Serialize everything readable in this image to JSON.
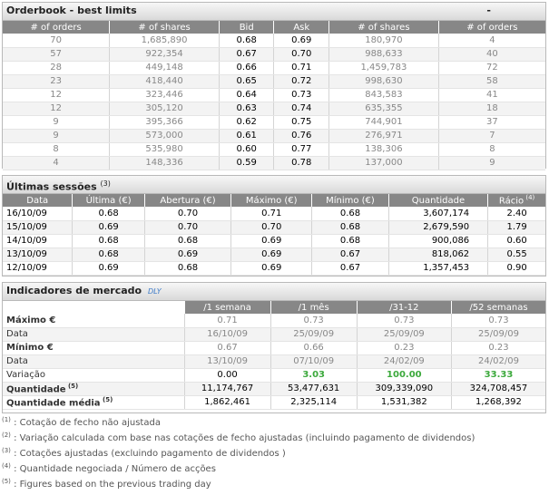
{
  "orderbook": {
    "title": "Orderbook - best limits",
    "collapse_label": "-",
    "columns": [
      "# of orders",
      "# of shares",
      "Bid",
      "Ask",
      "# of shares",
      "# of orders"
    ],
    "rows": [
      [
        "70",
        "1,685,890",
        "0.68",
        "0.69",
        "180,970",
        "4"
      ],
      [
        "57",
        "922,354",
        "0.67",
        "0.70",
        "988,633",
        "40"
      ],
      [
        "28",
        "449,148",
        "0.66",
        "0.71",
        "1,459,783",
        "72"
      ],
      [
        "23",
        "418,440",
        "0.65",
        "0.72",
        "998,630",
        "58"
      ],
      [
        "12",
        "323,446",
        "0.64",
        "0.73",
        "843,583",
        "41"
      ],
      [
        "12",
        "305,120",
        "0.63",
        "0.74",
        "635,355",
        "18"
      ],
      [
        "9",
        "395,366",
        "0.62",
        "0.75",
        "744,901",
        "37"
      ],
      [
        "9",
        "573,000",
        "0.61",
        "0.76",
        "276,971",
        "7"
      ],
      [
        "8",
        "535,980",
        "0.60",
        "0.77",
        "138,306",
        "8"
      ],
      [
        "4",
        "148,336",
        "0.59",
        "0.78",
        "137,000",
        "9"
      ]
    ]
  },
  "sessions": {
    "title": "Últimas sessões",
    "title_note": "(3)",
    "columns": [
      "Data",
      "Última (€)",
      "Abertura (€)",
      "Máximo (€)",
      "Mínimo (€)",
      "Quantidade",
      "Rácio"
    ],
    "ratio_note": "(4)",
    "rows": [
      [
        "16/10/09",
        "0.68",
        "0.70",
        "0.71",
        "0.68",
        "3,607,174",
        "2.40"
      ],
      [
        "15/10/09",
        "0.69",
        "0.70",
        "0.70",
        "0.68",
        "2,679,590",
        "1.79"
      ],
      [
        "14/10/09",
        "0.68",
        "0.68",
        "0.69",
        "0.68",
        "900,086",
        "0.60"
      ],
      [
        "13/10/09",
        "0.68",
        "0.69",
        "0.69",
        "0.67",
        "818,062",
        "0.55"
      ],
      [
        "12/10/09",
        "0.69",
        "0.68",
        "0.69",
        "0.67",
        "1,357,453",
        "0.90"
      ]
    ]
  },
  "indicators": {
    "title": "Indicadores de mercado",
    "tag": "DLY",
    "columns": [
      "/1 semana",
      "/1 mês",
      "/31-12",
      "/52 semanas"
    ],
    "rows": [
      {
        "label": "Máximo €",
        "note": "",
        "values": [
          "0.71",
          "0.73",
          "0.73",
          "0.73"
        ],
        "style": "normal"
      },
      {
        "label": "Data",
        "note": "",
        "values": [
          "16/10/09",
          "25/09/09",
          "25/09/09",
          "25/09/09"
        ],
        "style": "normal"
      },
      {
        "label": "Mínimo €",
        "note": "",
        "values": [
          "0.67",
          "0.66",
          "0.23",
          "0.23"
        ],
        "style": "normal"
      },
      {
        "label": "Data",
        "note": "",
        "values": [
          "13/10/09",
          "07/10/09",
          "24/02/09",
          "24/02/09"
        ],
        "style": "normal"
      },
      {
        "label": "Variação",
        "note": "",
        "values": [
          "0.00",
          "3.03",
          "100.00",
          "33.33"
        ],
        "style": "variation"
      },
      {
        "label": "Quantidade",
        "note": "(5)",
        "values": [
          "11,174,767",
          "53,477,631",
          "309,339,090",
          "324,708,457"
        ],
        "style": "dark"
      },
      {
        "label": "Quantidade média",
        "note": "(5)",
        "values": [
          "1,862,461",
          "2,325,114",
          "1,531,382",
          "1,268,392"
        ],
        "style": "dark"
      }
    ],
    "variation_colors": [
      "#000000",
      "#3ca93c",
      "#3ca93c",
      "#3ca93c"
    ]
  },
  "footnotes": [
    {
      "num": "(1)",
      "text": " : Cotação de fecho não ajustada"
    },
    {
      "num": "(2)",
      "text": " : Variação calculada com base nas cotações de fecho ajustadas (incluindo pagamento de dividendos)"
    },
    {
      "num": "(3)",
      "text": " : Cotações ajustadas (excluindo pagamento de dividendos )"
    },
    {
      "num": "(4)",
      "text": " : Quantidade negociada / Número de acções"
    },
    {
      "num": "(5)",
      "text": " : Figures based on the previous trading day"
    }
  ]
}
